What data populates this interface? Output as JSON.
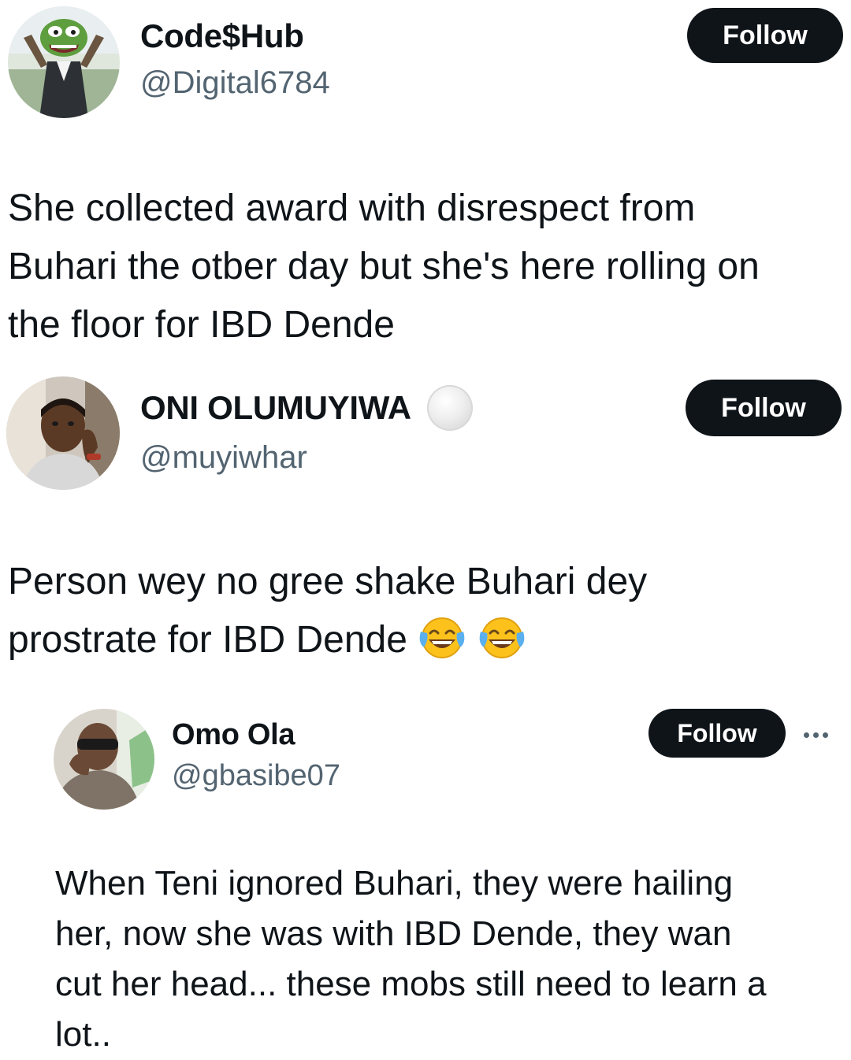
{
  "posts": [
    {
      "display_name": "Code$Hub",
      "handle": "@Digital6784",
      "follow_label": "Follow",
      "text_lines": [
        "She collected award with disrespect from",
        "Buhari the otber day but she's here rolling on",
        "the floor for IBD Dende"
      ]
    },
    {
      "display_name": "ONI OLUMUYIWA",
      "handle": "@muyiwhar",
      "follow_label": "Follow",
      "text_lines": [
        "Person wey no gree shake Buhari dey",
        "prostrate for IBD Dende"
      ],
      "emojis": [
        "face-with-tears-of-joy",
        "face-with-tears-of-joy"
      ]
    },
    {
      "display_name": "Omo Ola",
      "handle": "@gbasibe07",
      "follow_label": "Follow",
      "text_lines": [
        "When Teni ignored Buhari, they were hailing",
        "her, now she was with IBD Dende, they wan",
        "cut her head... these mobs still need to learn a",
        "lot.."
      ]
    }
  ],
  "colors": {
    "text": "#0f1419",
    "secondary": "#536471",
    "button_bg": "#0f1419",
    "button_text": "#ffffff"
  }
}
